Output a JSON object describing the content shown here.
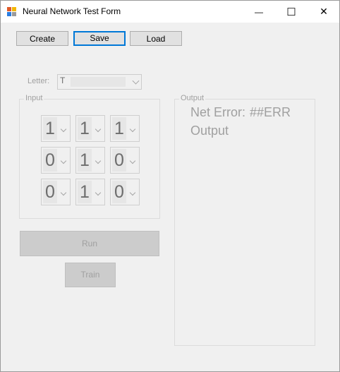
{
  "window": {
    "title": "Neural Network Test Form",
    "minimize_glyph": "—",
    "maximize_glyph": "☐",
    "close_glyph": "✕"
  },
  "toolbar": {
    "create_label": "Create",
    "save_label": "Save",
    "load_label": "Load"
  },
  "letter": {
    "label": "Letter:",
    "value": "T"
  },
  "input_group": {
    "title": "Input",
    "rows": [
      [
        "1",
        "1",
        "1"
      ],
      [
        "0",
        "1",
        "0"
      ],
      [
        "0",
        "1",
        "0"
      ]
    ]
  },
  "actions": {
    "run_label": "Run",
    "train_label": "Train"
  },
  "output_group": {
    "title": "Output",
    "net_error_label": "Net Error:",
    "net_error_value": "##ERR",
    "output_label": "Output"
  },
  "colors": {
    "accent": "#0078d7",
    "window_bg": "#f0f0f0",
    "disabled_text": "#a0a0a0"
  }
}
